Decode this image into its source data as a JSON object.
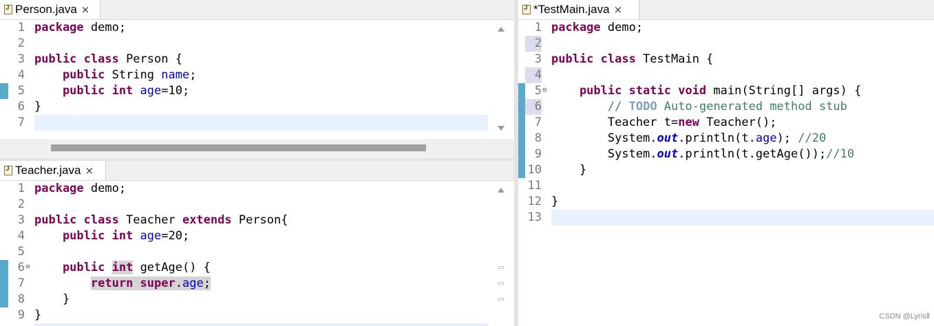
{
  "panes": {
    "person": {
      "tab_title": "Person.java",
      "line_numbers": [
        "1",
        "2",
        "3",
        "4",
        "5",
        "6",
        "7"
      ]
    },
    "teacher": {
      "tab_title": "Teacher.java",
      "line_numbers": [
        "1",
        "2",
        "3",
        "4",
        "5",
        "6",
        "7",
        "8",
        "9"
      ]
    },
    "testmain": {
      "tab_title": "*TestMain.java",
      "line_numbers": [
        "1",
        "2",
        "3",
        "4",
        "5",
        "6",
        "7",
        "8",
        "9",
        "10",
        "11",
        "12",
        "13"
      ]
    }
  },
  "code": {
    "person": {
      "l1a": "package",
      "l1b": " demo;",
      "l3a": "public class",
      "l3b": " Person {",
      "l4a": "    public",
      "l4b": " String ",
      "l4c": "name",
      "l4d": ";",
      "l5a": "    public int",
      "l5b": " ",
      "l5c": "age",
      "l5d": "=10;",
      "l6": "}"
    },
    "teacher": {
      "l1a": "package",
      "l1b": " demo;",
      "l3a": "public class",
      "l3b": " Teacher ",
      "l3c": "extends",
      "l3d": " Person{",
      "l4a": "    public int",
      "l4b": " ",
      "l4c": "age",
      "l4d": "=20;",
      "l6a": "    public",
      "l6b": " ",
      "l6c": "int",
      "l6d": " getAge() {",
      "l7a": "        ",
      "l7b": "return super",
      "l7c": ".",
      "l7d": "age",
      "l7e": ";",
      "l8": "    }",
      "l9": "}"
    },
    "testmain": {
      "l1a": "package",
      "l1b": " demo;",
      "l3a": "public class",
      "l3b": " TestMain {",
      "l5a": "    public static void",
      "l5b": " main(String[] args) {",
      "l6a": "        ",
      "l6b": "// ",
      "l6c": "TODO",
      "l6d": " Auto-generated method stub",
      "l7a": "        Teacher t=",
      "l7b": "new",
      "l7c": " Teacher();",
      "l8a": "        System.",
      "l8b": "out",
      "l8c": ".println(t.",
      "l8d": "age",
      "l8e": "); ",
      "l8f": "//20",
      "l9a": "        System.",
      "l9b": "out",
      "l9c": ".println(t.getAge());",
      "l9d": "//10",
      "l10": "    }",
      "l12": "}"
    }
  },
  "watermark": "CSDN @LyrisⅡ"
}
